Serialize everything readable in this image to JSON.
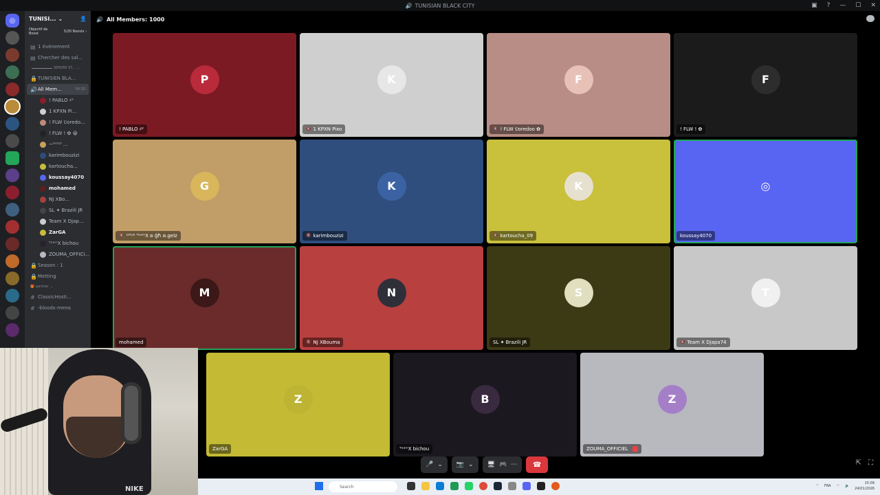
{
  "window": {
    "title": "TUNISIAN BLACK CITY"
  },
  "sidebar": {
    "guild_name": "TUNISI...",
    "boost": {
      "label": "Objectif de Boost",
      "value": "5/20 Boosts ›"
    },
    "top_channels": [
      {
        "label": "1 événement"
      },
      {
        "label": "Chercher des sal..."
      }
    ],
    "category_server": "SERVER ST...",
    "channels": [
      {
        "label": "TUNISIEN BLA..."
      }
    ],
    "voice_channel": {
      "label": "All Mem...",
      "count": "00:33"
    },
    "voice_users": [
      {
        "name": "! PABLO ♯²",
        "color": "#8b1d2a"
      },
      {
        "name": "1 KPXN Pi...",
        "color": "#cfcfcf"
      },
      {
        "name": "! FLW 𝕺oredo...",
        "color": "#c08878"
      },
      {
        "name": "! FLW ! ✿ 😀",
        "color": "#222"
      },
      {
        "name": "~ᴳᴼᴸᴰ ...",
        "color": "#c9a15a"
      },
      {
        "name": "karimbouzizi",
        "color": "#2c4d7e"
      },
      {
        "name": "kartoucha...",
        "color": "#c5be3c"
      },
      {
        "name": "koussay4070",
        "color": "#5865f2",
        "me": true
      },
      {
        "name": "mohamed",
        "color": "#5a2020",
        "me": true
      },
      {
        "name": "NJ XBo...",
        "color": "#a84040"
      },
      {
        "name": "SL ✦ Brazili JR",
        "color": "#444"
      },
      {
        "name": "Team X Djap...",
        "color": "#ccc"
      },
      {
        "name": "ZarGA",
        "color": "#c8bc3c",
        "me": true
      },
      {
        "name": "ᵀᵉᵃᵐX bichou",
        "color": "#2a2030"
      },
      {
        "name": "ZOUMA_OFFICI...",
        "color": "#b9b9c4"
      }
    ],
    "more_channels": [
      {
        "label": "Season : 1"
      },
      {
        "label": "Metting"
      }
    ],
    "category_partner": "partner",
    "partner_channels": [
      {
        "label": "ClassicHosti..."
      },
      {
        "label": "-bloods-mena"
      }
    ]
  },
  "stage": {
    "title": "All Members: 1000"
  },
  "tiles": [
    {
      "name": "! PABLO ♯²",
      "bg": "#7c1a24",
      "avatar_bg": "#b92b3a",
      "avatar_text": "P",
      "muted": false
    },
    {
      "name": "1 KPXN Pixo",
      "bg": "#cfcfcf",
      "avatar_bg": "#e7e7e7",
      "avatar_text": "K",
      "muted": true
    },
    {
      "name": "! FLW 𝕺oredoo ✿",
      "bg": "#b88d85",
      "avatar_bg": "#e8c1b6",
      "avatar_text": "F",
      "muted": true
    },
    {
      "name": "! FLW ! ✿",
      "bg": "#1b1b1b",
      "avatar_bg": "#2d2d2d",
      "avatar_text": "F",
      "muted": false
    },
    {
      "name": "ᴳᴼᴸᴰ ᵀᵉᵃᵐX ʚ ğħ ɞ.gelz",
      "bg": "#c19d68",
      "avatar_bg": "#d9b65b",
      "avatar_text": "G",
      "muted": true
    },
    {
      "name": "karimbouzizi",
      "bg": "#2f4e7e",
      "avatar_bg": "#3b63a3",
      "avatar_text": "K",
      "muted": true
    },
    {
      "name": "kartoucha_09",
      "bg": "#c9c03c",
      "avatar_bg": "#e6e1cf",
      "avatar_text": "K",
      "muted": true
    },
    {
      "name": "koussay4070",
      "bg": "#5865f2",
      "avatar_bg": "#5865f2",
      "avatar_text": "◎",
      "muted": false
    },
    {
      "name": "mohamed",
      "bg": "#6b2b2b",
      "avatar_bg": "#3c1818",
      "avatar_text": "M",
      "muted": false
    },
    {
      "name": "NJ XBouma",
      "bg": "#b8403f",
      "avatar_bg": "#2f2f39",
      "avatar_text": "N",
      "muted": true
    },
    {
      "name": "SL ✦ Brazili JR",
      "bg": "#3c3a15",
      "avatar_bg": "#e0e0c0",
      "avatar_text": "S",
      "muted": false
    },
    {
      "name": "Team X Djapa74",
      "bg": "#c8c8c8",
      "avatar_bg": "#f0f0f0",
      "avatar_text": "T",
      "muted": true
    },
    {
      "name": "ZarGA",
      "bg": "#c4ba34",
      "avatar_bg": "#bdb434",
      "avatar_text": "Z",
      "muted": false
    },
    {
      "name": "ᵀᵉᵃᵐX bichou",
      "bg": "#1b181f",
      "avatar_bg": "#3a2a3f",
      "avatar_text": "B",
      "muted": false
    },
    {
      "name": "ZOUMA_OFFICIEL",
      "bg": "#b8b8bf",
      "avatar_bg": "#a47fc7",
      "avatar_text": "Z",
      "muted": false,
      "badge": true
    }
  ],
  "webcam": {
    "logo": "NIKE"
  },
  "taskbar": {
    "search_placeholder": "Search",
    "time": "15:09",
    "date": "24/01/2026",
    "lang": "FRA"
  },
  "controls": {
    "mic_icon": "🎤",
    "camera_icon": "📷",
    "share_icon": "🖥",
    "activity_icon": "🎮",
    "more_icon": "⋯",
    "hangup_icon": "☎"
  }
}
